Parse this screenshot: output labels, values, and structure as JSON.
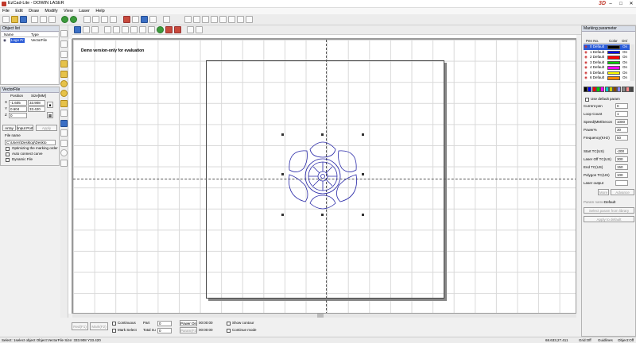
{
  "window": {
    "title": "EzCad-Lite - DOWIN LASER",
    "logo": "3D"
  },
  "menu": [
    "File",
    "Edit",
    "Draw",
    "Modify",
    "View",
    "Laser",
    "Help"
  ],
  "object_list": {
    "title": "Object list",
    "col_name": "Name",
    "col_type": "Type",
    "row_name": "Logo Pr",
    "row_type": "VectorFile"
  },
  "vectorfile": {
    "title": "VectorFile",
    "col_position": "Position",
    "col_size": "Size[MM]",
    "x_label": "X",
    "y_label": "Y",
    "z_label": "Z",
    "x_pos": "-1.605",
    "x_size": "33.908",
    "y_pos": "0.604",
    "y_size": "33.420",
    "z_pos": "0",
    "array_btn": "Array",
    "input_port_btn": "Input Port",
    "apply_btn": "Apply",
    "file_name_label": "File name",
    "file_name_value": "C:\\Users\\Desktop\\Deskto",
    "opt_marking": "Optimizing the marking order",
    "auto_connect": "Auto connect curve",
    "dynamic_file": "Dynamic File"
  },
  "canvas": {
    "demo_text": "Demo version-only for evaluation"
  },
  "marking": {
    "title": "Marking parameter",
    "col_pen": "Pen No.",
    "col_color": "Color",
    "col_on": "On/",
    "pens": [
      {
        "name": "0 Default",
        "color": "#000000",
        "on": "On"
      },
      {
        "name": "1 Default",
        "color": "#0000ff",
        "on": "On"
      },
      {
        "name": "2 Default",
        "color": "#ff0000",
        "on": "On"
      },
      {
        "name": "3 Default",
        "color": "#00cc00",
        "on": "On"
      },
      {
        "name": "4 Default",
        "color": "#ff00ff",
        "on": "On"
      },
      {
        "name": "5 Default",
        "color": "#ffff00",
        "on": "On"
      },
      {
        "name": "6 Default",
        "color": "#ff8800",
        "on": "On"
      }
    ],
    "palette": [
      "#000000",
      "#0000ff",
      "#ff0000",
      "#00cc00",
      "#ff00ff",
      "#00cccc",
      "#cccc00",
      "#884400",
      "#8888ff",
      "#888888",
      "#ff8888",
      "#444444"
    ],
    "use_default": "Use default param",
    "current_pen_label": "Current pen",
    "current_pen": "0",
    "loop_count_label": "Loop Count",
    "loop_count": "1",
    "speed_label": "Speed(MM/Secon",
    "speed": "1000",
    "power_label": "Power%",
    "power": "30",
    "freq_label": "Frequency(KHz)",
    "freq": "50",
    "start_tc_label": "Start TC(US)",
    "start_tc": "-200",
    "laser_off_label": "Laser Off TC(US)",
    "laser_off": "300",
    "end_tc_label": "End TC(US)",
    "end_tc": "150",
    "polygon_tc_label": "Polygon TC(US)",
    "polygon_tc": "100",
    "laser_output_label": "Laser output",
    "more_btn": "More",
    "advance_btn": "Advance",
    "param_name_label": "Param name",
    "param_name": "Default",
    "select_param_btn": "Select param from library",
    "apply_default_btn": "Apply to default"
  },
  "bottom": {
    "red_btn": "Red(F1)",
    "mark_btn": "Mark(F2)",
    "continuous": "Continuous",
    "part_label": "Part",
    "part_value": "0",
    "power_on_label": "Power On",
    "power_on_time": "00:00:00",
    "show_contour": "Show contour",
    "mark_select": "Mark Select",
    "total_label": "Total nu",
    "total_value": "0",
    "param_btn": "Param(F3)",
    "time2": "00:00:00",
    "continue_mode": "Continue mode"
  },
  "status": {
    "left": "Select: 1select object Object:VectorFile Size: 333.908 Y33.420",
    "coords": "68.633,27.411",
    "grid": "Grid:Off",
    "guidlines": "Guidlines",
    "object": "Object:Off"
  }
}
